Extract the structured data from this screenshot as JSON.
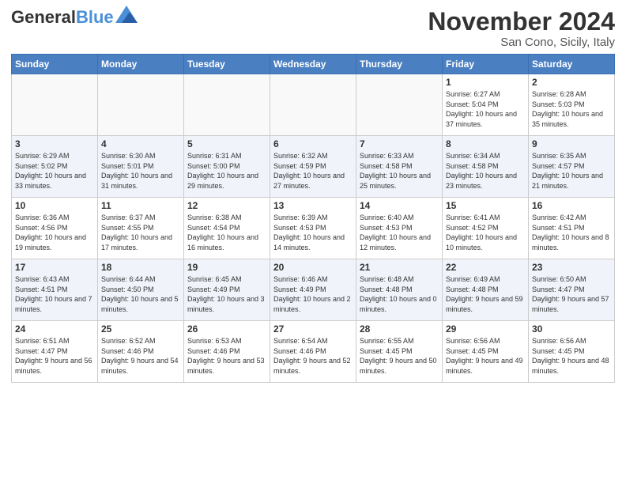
{
  "header": {
    "logo_general": "General",
    "logo_blue": "Blue",
    "month_title": "November 2024",
    "location": "San Cono, Sicily, Italy"
  },
  "weekdays": [
    "Sunday",
    "Monday",
    "Tuesday",
    "Wednesday",
    "Thursday",
    "Friday",
    "Saturday"
  ],
  "weeks": [
    [
      {
        "day": "",
        "info": ""
      },
      {
        "day": "",
        "info": ""
      },
      {
        "day": "",
        "info": ""
      },
      {
        "day": "",
        "info": ""
      },
      {
        "day": "",
        "info": ""
      },
      {
        "day": "1",
        "info": "Sunrise: 6:27 AM\nSunset: 5:04 PM\nDaylight: 10 hours and 37 minutes."
      },
      {
        "day": "2",
        "info": "Sunrise: 6:28 AM\nSunset: 5:03 PM\nDaylight: 10 hours and 35 minutes."
      }
    ],
    [
      {
        "day": "3",
        "info": "Sunrise: 6:29 AM\nSunset: 5:02 PM\nDaylight: 10 hours and 33 minutes."
      },
      {
        "day": "4",
        "info": "Sunrise: 6:30 AM\nSunset: 5:01 PM\nDaylight: 10 hours and 31 minutes."
      },
      {
        "day": "5",
        "info": "Sunrise: 6:31 AM\nSunset: 5:00 PM\nDaylight: 10 hours and 29 minutes."
      },
      {
        "day": "6",
        "info": "Sunrise: 6:32 AM\nSunset: 4:59 PM\nDaylight: 10 hours and 27 minutes."
      },
      {
        "day": "7",
        "info": "Sunrise: 6:33 AM\nSunset: 4:58 PM\nDaylight: 10 hours and 25 minutes."
      },
      {
        "day": "8",
        "info": "Sunrise: 6:34 AM\nSunset: 4:58 PM\nDaylight: 10 hours and 23 minutes."
      },
      {
        "day": "9",
        "info": "Sunrise: 6:35 AM\nSunset: 4:57 PM\nDaylight: 10 hours and 21 minutes."
      }
    ],
    [
      {
        "day": "10",
        "info": "Sunrise: 6:36 AM\nSunset: 4:56 PM\nDaylight: 10 hours and 19 minutes."
      },
      {
        "day": "11",
        "info": "Sunrise: 6:37 AM\nSunset: 4:55 PM\nDaylight: 10 hours and 17 minutes."
      },
      {
        "day": "12",
        "info": "Sunrise: 6:38 AM\nSunset: 4:54 PM\nDaylight: 10 hours and 16 minutes."
      },
      {
        "day": "13",
        "info": "Sunrise: 6:39 AM\nSunset: 4:53 PM\nDaylight: 10 hours and 14 minutes."
      },
      {
        "day": "14",
        "info": "Sunrise: 6:40 AM\nSunset: 4:53 PM\nDaylight: 10 hours and 12 minutes."
      },
      {
        "day": "15",
        "info": "Sunrise: 6:41 AM\nSunset: 4:52 PM\nDaylight: 10 hours and 10 minutes."
      },
      {
        "day": "16",
        "info": "Sunrise: 6:42 AM\nSunset: 4:51 PM\nDaylight: 10 hours and 8 minutes."
      }
    ],
    [
      {
        "day": "17",
        "info": "Sunrise: 6:43 AM\nSunset: 4:51 PM\nDaylight: 10 hours and 7 minutes."
      },
      {
        "day": "18",
        "info": "Sunrise: 6:44 AM\nSunset: 4:50 PM\nDaylight: 10 hours and 5 minutes."
      },
      {
        "day": "19",
        "info": "Sunrise: 6:45 AM\nSunset: 4:49 PM\nDaylight: 10 hours and 3 minutes."
      },
      {
        "day": "20",
        "info": "Sunrise: 6:46 AM\nSunset: 4:49 PM\nDaylight: 10 hours and 2 minutes."
      },
      {
        "day": "21",
        "info": "Sunrise: 6:48 AM\nSunset: 4:48 PM\nDaylight: 10 hours and 0 minutes."
      },
      {
        "day": "22",
        "info": "Sunrise: 6:49 AM\nSunset: 4:48 PM\nDaylight: 9 hours and 59 minutes."
      },
      {
        "day": "23",
        "info": "Sunrise: 6:50 AM\nSunset: 4:47 PM\nDaylight: 9 hours and 57 minutes."
      }
    ],
    [
      {
        "day": "24",
        "info": "Sunrise: 6:51 AM\nSunset: 4:47 PM\nDaylight: 9 hours and 56 minutes."
      },
      {
        "day": "25",
        "info": "Sunrise: 6:52 AM\nSunset: 4:46 PM\nDaylight: 9 hours and 54 minutes."
      },
      {
        "day": "26",
        "info": "Sunrise: 6:53 AM\nSunset: 4:46 PM\nDaylight: 9 hours and 53 minutes."
      },
      {
        "day": "27",
        "info": "Sunrise: 6:54 AM\nSunset: 4:46 PM\nDaylight: 9 hours and 52 minutes."
      },
      {
        "day": "28",
        "info": "Sunrise: 6:55 AM\nSunset: 4:45 PM\nDaylight: 9 hours and 50 minutes."
      },
      {
        "day": "29",
        "info": "Sunrise: 6:56 AM\nSunset: 4:45 PM\nDaylight: 9 hours and 49 minutes."
      },
      {
        "day": "30",
        "info": "Sunrise: 6:56 AM\nSunset: 4:45 PM\nDaylight: 9 hours and 48 minutes."
      }
    ]
  ]
}
